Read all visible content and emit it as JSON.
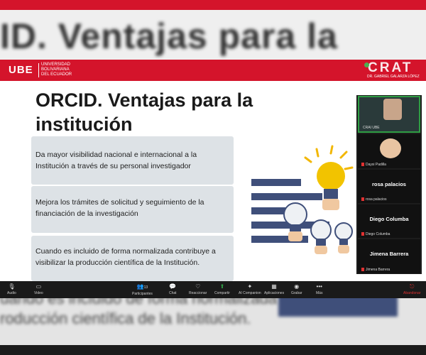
{
  "background": {
    "title_text": "ID. Ventajas para la",
    "line1": "uando es incluido de forma normalizada contribuye a",
    "line2": "roducción científica de la Institución."
  },
  "slide": {
    "logo": "UBE",
    "university": [
      "Universidad",
      "Bolivariana",
      "del Ecuador"
    ],
    "crat": "CRAT",
    "crat_sub": "DR. GABRIEL GALARZA LÓPEZ",
    "nav": "Speaker View · Vista",
    "title_line1": "ORCID. Ventajas para la",
    "title_line2": "institución",
    "cards": [
      "Da mayor visibilidad nacional e internacional a la Institución a través de su personal investigador",
      "Mejora los trámites de solicitud y seguimiento de la financiación de la investigación",
      "Cuando es incluido de forma normalizada contribuye a visibilizar la producción científica de la Institución."
    ]
  },
  "participants": [
    {
      "label": "CRAI UBE",
      "type": "video"
    },
    {
      "label": "Daysi Padilla",
      "type": "photo"
    },
    {
      "display": "rosa palacios",
      "label": "rosa palacios",
      "type": "name"
    },
    {
      "display": "Diego Columba",
      "label": "Diego Columba",
      "type": "name"
    },
    {
      "display": "Jimena Barrera",
      "label": "Jimena Barrera",
      "type": "name"
    }
  ],
  "toolbar": {
    "audio": "Audio",
    "video": "Video",
    "participants": "Participantes",
    "participants_count": "13",
    "chat": "Chat",
    "reactions": "Reaccionar",
    "share": "Compartir",
    "ai": "AI Companion",
    "apps": "Aplicaciones",
    "record": "Grabar",
    "more": "Más",
    "leave": "Abandonar"
  },
  "colors": {
    "brand_red": "#d4142b",
    "card_bg": "#dde2e6",
    "toolbar_bg": "#1a1a1a",
    "share_green": "#2f9e44"
  }
}
